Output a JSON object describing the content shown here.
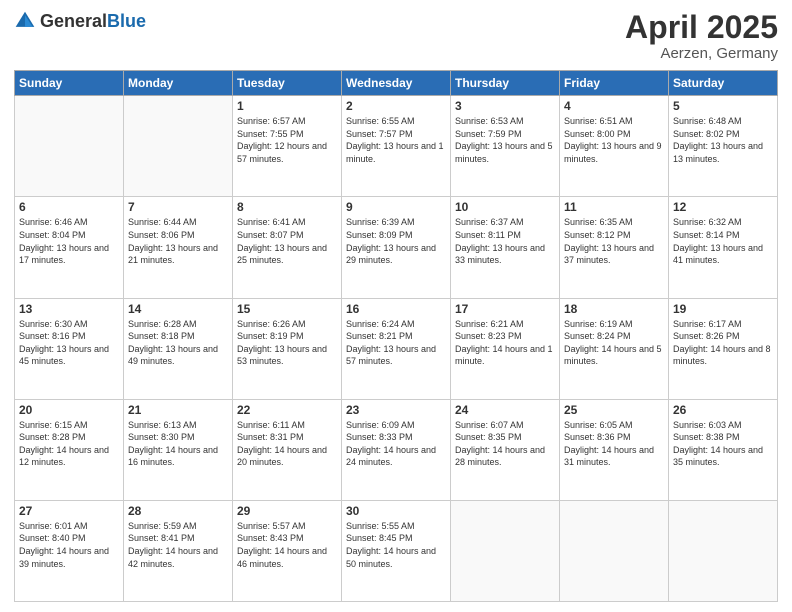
{
  "header": {
    "logo_general": "General",
    "logo_blue": "Blue",
    "month": "April 2025",
    "location": "Aerzen, Germany"
  },
  "days_of_week": [
    "Sunday",
    "Monday",
    "Tuesday",
    "Wednesday",
    "Thursday",
    "Friday",
    "Saturday"
  ],
  "weeks": [
    [
      {
        "day": "",
        "text": ""
      },
      {
        "day": "",
        "text": ""
      },
      {
        "day": "1",
        "text": "Sunrise: 6:57 AM\nSunset: 7:55 PM\nDaylight: 12 hours and 57 minutes."
      },
      {
        "day": "2",
        "text": "Sunrise: 6:55 AM\nSunset: 7:57 PM\nDaylight: 13 hours and 1 minute."
      },
      {
        "day": "3",
        "text": "Sunrise: 6:53 AM\nSunset: 7:59 PM\nDaylight: 13 hours and 5 minutes."
      },
      {
        "day": "4",
        "text": "Sunrise: 6:51 AM\nSunset: 8:00 PM\nDaylight: 13 hours and 9 minutes."
      },
      {
        "day": "5",
        "text": "Sunrise: 6:48 AM\nSunset: 8:02 PM\nDaylight: 13 hours and 13 minutes."
      }
    ],
    [
      {
        "day": "6",
        "text": "Sunrise: 6:46 AM\nSunset: 8:04 PM\nDaylight: 13 hours and 17 minutes."
      },
      {
        "day": "7",
        "text": "Sunrise: 6:44 AM\nSunset: 8:06 PM\nDaylight: 13 hours and 21 minutes."
      },
      {
        "day": "8",
        "text": "Sunrise: 6:41 AM\nSunset: 8:07 PM\nDaylight: 13 hours and 25 minutes."
      },
      {
        "day": "9",
        "text": "Sunrise: 6:39 AM\nSunset: 8:09 PM\nDaylight: 13 hours and 29 minutes."
      },
      {
        "day": "10",
        "text": "Sunrise: 6:37 AM\nSunset: 8:11 PM\nDaylight: 13 hours and 33 minutes."
      },
      {
        "day": "11",
        "text": "Sunrise: 6:35 AM\nSunset: 8:12 PM\nDaylight: 13 hours and 37 minutes."
      },
      {
        "day": "12",
        "text": "Sunrise: 6:32 AM\nSunset: 8:14 PM\nDaylight: 13 hours and 41 minutes."
      }
    ],
    [
      {
        "day": "13",
        "text": "Sunrise: 6:30 AM\nSunset: 8:16 PM\nDaylight: 13 hours and 45 minutes."
      },
      {
        "day": "14",
        "text": "Sunrise: 6:28 AM\nSunset: 8:18 PM\nDaylight: 13 hours and 49 minutes."
      },
      {
        "day": "15",
        "text": "Sunrise: 6:26 AM\nSunset: 8:19 PM\nDaylight: 13 hours and 53 minutes."
      },
      {
        "day": "16",
        "text": "Sunrise: 6:24 AM\nSunset: 8:21 PM\nDaylight: 13 hours and 57 minutes."
      },
      {
        "day": "17",
        "text": "Sunrise: 6:21 AM\nSunset: 8:23 PM\nDaylight: 14 hours and 1 minute."
      },
      {
        "day": "18",
        "text": "Sunrise: 6:19 AM\nSunset: 8:24 PM\nDaylight: 14 hours and 5 minutes."
      },
      {
        "day": "19",
        "text": "Sunrise: 6:17 AM\nSunset: 8:26 PM\nDaylight: 14 hours and 8 minutes."
      }
    ],
    [
      {
        "day": "20",
        "text": "Sunrise: 6:15 AM\nSunset: 8:28 PM\nDaylight: 14 hours and 12 minutes."
      },
      {
        "day": "21",
        "text": "Sunrise: 6:13 AM\nSunset: 8:30 PM\nDaylight: 14 hours and 16 minutes."
      },
      {
        "day": "22",
        "text": "Sunrise: 6:11 AM\nSunset: 8:31 PM\nDaylight: 14 hours and 20 minutes."
      },
      {
        "day": "23",
        "text": "Sunrise: 6:09 AM\nSunset: 8:33 PM\nDaylight: 14 hours and 24 minutes."
      },
      {
        "day": "24",
        "text": "Sunrise: 6:07 AM\nSunset: 8:35 PM\nDaylight: 14 hours and 28 minutes."
      },
      {
        "day": "25",
        "text": "Sunrise: 6:05 AM\nSunset: 8:36 PM\nDaylight: 14 hours and 31 minutes."
      },
      {
        "day": "26",
        "text": "Sunrise: 6:03 AM\nSunset: 8:38 PM\nDaylight: 14 hours and 35 minutes."
      }
    ],
    [
      {
        "day": "27",
        "text": "Sunrise: 6:01 AM\nSunset: 8:40 PM\nDaylight: 14 hours and 39 minutes."
      },
      {
        "day": "28",
        "text": "Sunrise: 5:59 AM\nSunset: 8:41 PM\nDaylight: 14 hours and 42 minutes."
      },
      {
        "day": "29",
        "text": "Sunrise: 5:57 AM\nSunset: 8:43 PM\nDaylight: 14 hours and 46 minutes."
      },
      {
        "day": "30",
        "text": "Sunrise: 5:55 AM\nSunset: 8:45 PM\nDaylight: 14 hours and 50 minutes."
      },
      {
        "day": "",
        "text": ""
      },
      {
        "day": "",
        "text": ""
      },
      {
        "day": "",
        "text": ""
      }
    ]
  ]
}
